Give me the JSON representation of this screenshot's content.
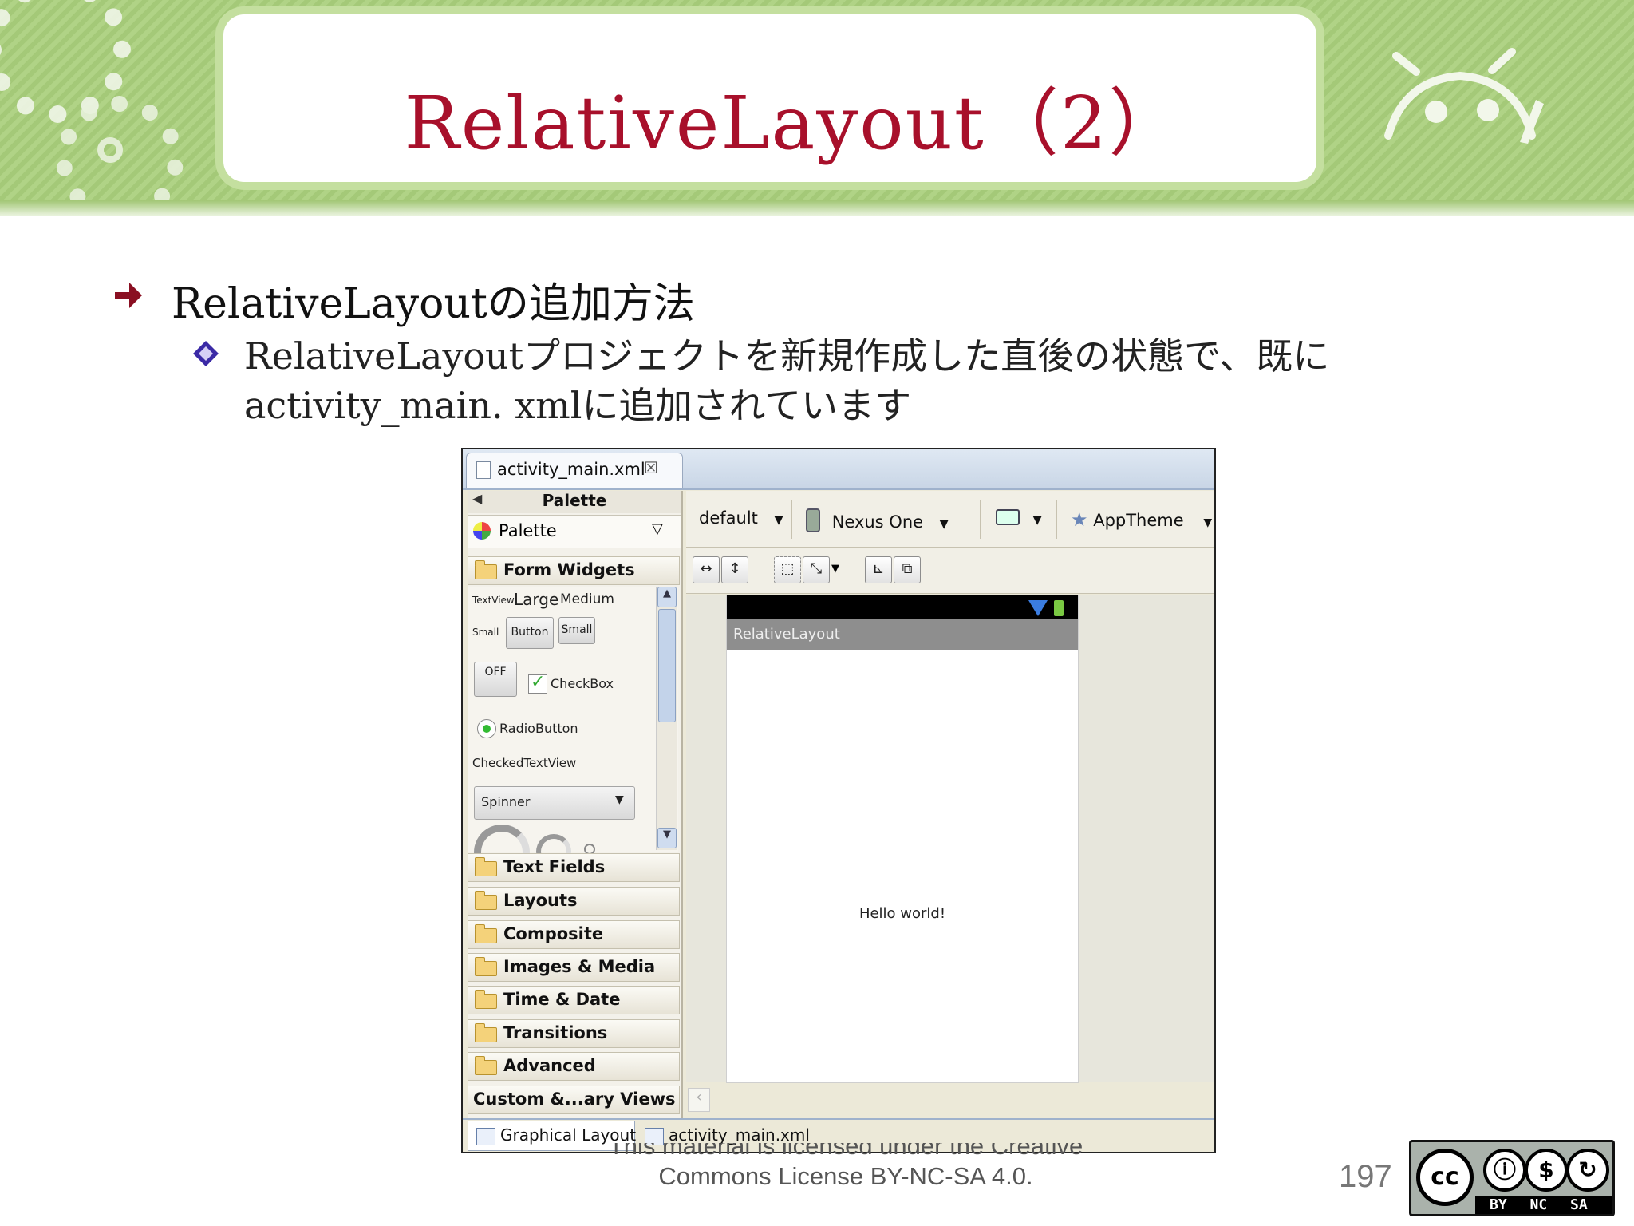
{
  "slide": {
    "title": "RelativeLayout（2）",
    "bullet1": "RelativeLayoutの追加方法",
    "bullet2": "RelativeLayoutプロジェクトを新規作成した直後の状態で、既に activity_main. xmlに追加されています",
    "license_line1": "This material is licensed under the Creative",
    "license_line2": "Commons License BY-NC-SA 4.0.",
    "page_number": "197",
    "cc_badge": {
      "logo": "cc",
      "terms": "BY NC SA",
      "by_icon": "person-icon",
      "nc_icon": "dollar-icon",
      "sa_icon": "share-alike-icon"
    },
    "title_color": "#a8102b",
    "header_color": "#a9cf7c"
  },
  "eclipse": {
    "editor_tab": {
      "label": "activity_main.xml",
      "close": "☒"
    },
    "palette": {
      "header": "Palette",
      "dropdown_label": "Palette",
      "form_widgets": "Form Widgets",
      "widgets": {
        "textview": "TextView",
        "large": "Large",
        "medium": "Medium",
        "small": "Small",
        "button": "Button",
        "small_button": "Small",
        "toggle_off": "OFF",
        "checkbox": "CheckBox",
        "radiobutton": "RadioButton",
        "checkedtextview": "CheckedTextView",
        "spinner": "Spinner"
      },
      "categories": [
        "Text Fields",
        "Layouts",
        "Composite",
        "Images & Media",
        "Time & Date",
        "Transitions",
        "Advanced",
        "Custom &...ary Views"
      ]
    },
    "toolbar": {
      "config": "default",
      "device": "Nexus One",
      "theme": "AppTheme"
    },
    "preview": {
      "action_bar_title": "RelativeLayout",
      "content_text": "Hello world!"
    },
    "bottom_tabs": [
      "Graphical Layout",
      "activity_main.xml"
    ]
  }
}
